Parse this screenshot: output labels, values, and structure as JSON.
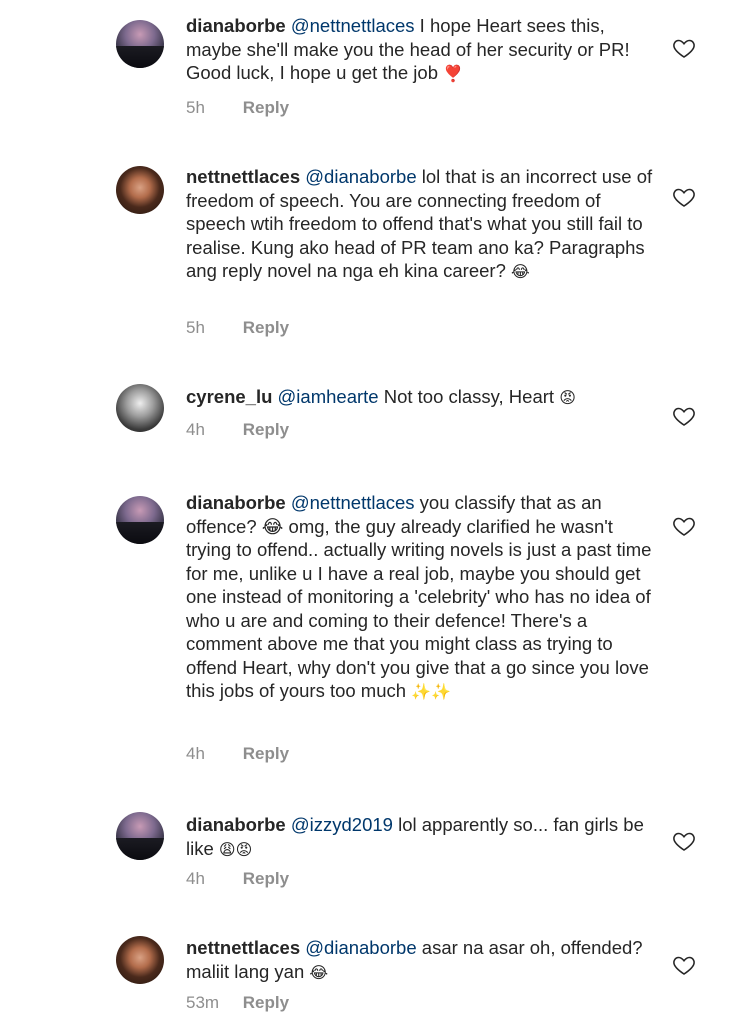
{
  "comments": [
    {
      "username": "dianaborbe",
      "mention": "@nettnettlaces",
      "text": " I hope Heart sees this, maybe she'll make you the head of her security or PR! Good luck, I hope u get the job",
      "emoji": "❣️",
      "time": "5h",
      "reply": "Reply",
      "avatar": "sunset-avatar"
    },
    {
      "username": "nettnettlaces",
      "mention": "@dianaborbe",
      "text": " lol that is an incorrect use of freedom of speech. You are connecting freedom of speech wtih freedom to offend that's what you still fail to realise. Kung ako head of  PR team ano ka? Paragraphs ang reply novel na nga eh kina career?",
      "emoji": "😂",
      "time": "5h",
      "reply": "Reply",
      "avatar": "portrait-avatar"
    },
    {
      "username": "cyrene_lu",
      "mention": "@iamhearte",
      "text": " Not too classy, Heart",
      "emoji": "😡",
      "time": "4h",
      "reply": "Reply",
      "avatar": "bw-avatar"
    },
    {
      "username": "dianaborbe",
      "mention": "@nettnettlaces",
      "text": " you classify that as an offence? 😂 omg, the guy already clarified he wasn't trying to offend.. actually writing novels is just a past time for me, unlike u I have a real job, maybe you should get one instead of monitoring a 'celebrity' who has no idea of who u are and coming to their defence! There's a comment above me that you might class as trying to offend Heart, why don't you give that a go since you love this jobs of yours too much",
      "emoji": "✨✨",
      "time": "4h",
      "reply": "Reply",
      "avatar": "sunset-avatar"
    },
    {
      "username": "dianaborbe",
      "mention": "@izzyd2019",
      "text": " lol apparently so... fan girls be like",
      "emoji": "😩😡",
      "time": "4h",
      "reply": "Reply",
      "avatar": "sunset-avatar"
    },
    {
      "username": "nettnettlaces",
      "mention": "@dianaborbe",
      "text": " asar na asar oh, offended? maliit lang yan",
      "emoji": "😂",
      "time": "53m",
      "reply": "Reply",
      "avatar": "portrait-avatar"
    }
  ],
  "icons": {
    "like": "heart-outline-icon"
  }
}
